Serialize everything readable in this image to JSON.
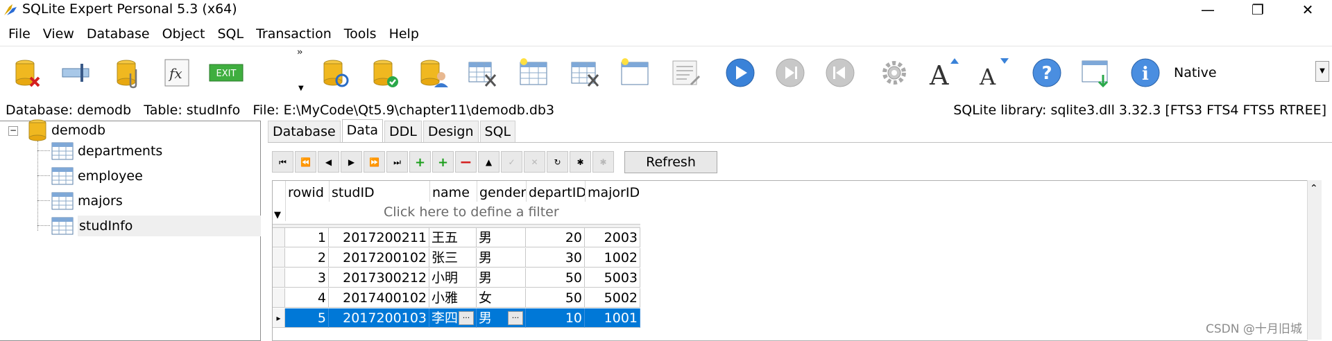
{
  "window": {
    "title": "SQLite Expert Personal 5.3 (x64)"
  },
  "menu": [
    "File",
    "View",
    "Database",
    "Object",
    "SQL",
    "Transaction",
    "Tools",
    "Help"
  ],
  "toolbar": {
    "icons": [
      "db-delete-icon",
      "db-detach-icon",
      "db-attach-icon",
      "function-icon",
      "exit-icon",
      "db-refresh-icon",
      "db-check-icon",
      "db-user-icon",
      "db-tools-icon",
      "table-new-icon",
      "table-design-icon",
      "table-window-icon",
      "sql-editor-icon",
      "play-icon",
      "step-icon",
      "back-icon",
      "gear-icon",
      "font-increase-icon",
      "font-decrease-icon",
      "help-icon",
      "import-icon",
      "info-icon"
    ],
    "exit_label": "EXIT",
    "native_label": "Native"
  },
  "status": {
    "database": "Database: demodb",
    "table": "Table: studInfo",
    "file": "File: E:\\MyCode\\Qt5.9\\chapter11\\demodb.db3",
    "library": "SQLite library: sqlite3.dll 3.32.3 [FTS3 FTS4 FTS5 RTREE]"
  },
  "tree": {
    "root": "demodb",
    "tables": [
      "departments",
      "employee",
      "majors",
      "studInfo"
    ],
    "selected": "studInfo"
  },
  "tabs": [
    "Database",
    "Data",
    "DDL",
    "Design",
    "SQL"
  ],
  "active_tab": "Data",
  "navigator": {
    "refresh_label": "Refresh"
  },
  "grid": {
    "columns": [
      "rowid",
      "studID",
      "name",
      "gender",
      "departID",
      "majorID"
    ],
    "filter_placeholder": "Click here to define a filter",
    "rows": [
      {
        "rowid": "1",
        "studID": "2017200211",
        "name": "王五",
        "gender": "男",
        "departID": "20",
        "majorID": "2003"
      },
      {
        "rowid": "2",
        "studID": "2017200102",
        "name": "张三",
        "gender": "男",
        "departID": "30",
        "majorID": "1002"
      },
      {
        "rowid": "3",
        "studID": "2017300212",
        "name": "小明",
        "gender": "男",
        "departID": "50",
        "majorID": "5003"
      },
      {
        "rowid": "4",
        "studID": "2017400102",
        "name": "小雅",
        "gender": "女",
        "departID": "50",
        "majorID": "5002"
      },
      {
        "rowid": "5",
        "studID": "2017200103",
        "name": "李四",
        "gender": "男",
        "departID": "10",
        "majorID": "1001"
      }
    ],
    "selected_row": 4,
    "ellipsis": "···"
  },
  "watermark": "CSDN @十月旧城"
}
